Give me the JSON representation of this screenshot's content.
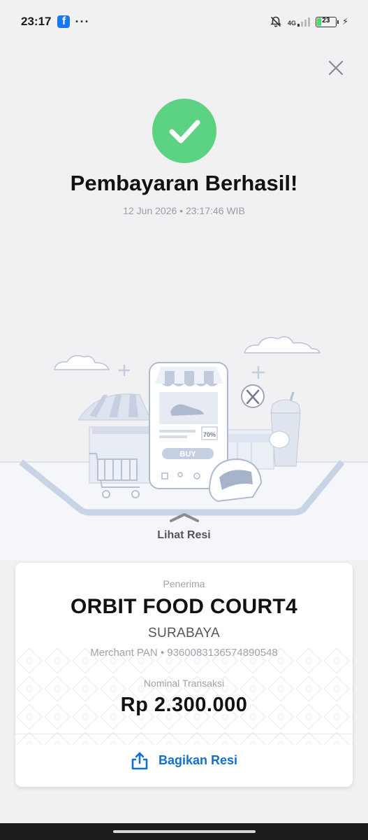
{
  "status_bar": {
    "time": "23:17",
    "app_icon": "facebook-icon",
    "more": "···",
    "network": "4G",
    "battery": "23",
    "battery_level": 0.23,
    "icons": [
      "bell-muted-icon",
      "signal-icon",
      "battery-icon",
      "charging-icon"
    ]
  },
  "header": {
    "close_icon": "close-icon"
  },
  "result": {
    "status_icon": "check-circle-icon",
    "title": "Pembayaran Berhasil!",
    "timestamp": "12 Jun 2026 • 23:17:46 WIB"
  },
  "illustration": {
    "buy_label": "BUY",
    "discount_label": "70%"
  },
  "view_receipt": {
    "label": "Lihat Resi",
    "icon": "chevron-up-icon"
  },
  "receipt": {
    "recipient_label": "Penerima",
    "merchant_name": "ORBIT FOOD COURT4",
    "merchant_city": "SURABAYA",
    "merchant_pan": "Merchant PAN • 9360083136574890548",
    "amount_label": "Nominal Transaksi",
    "amount": "Rp 2.300.000",
    "share_label": "Bagikan Resi",
    "share_icon": "share-icon"
  },
  "colors": {
    "success": "#5bd382",
    "accent": "#1170cf",
    "background": "#f1f1f3"
  }
}
